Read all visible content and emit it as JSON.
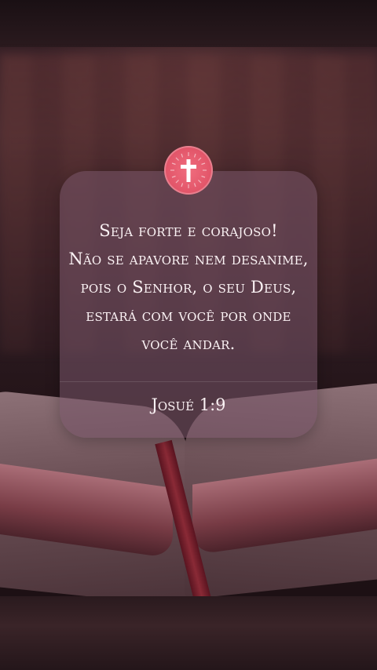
{
  "card": {
    "verse_lines": [
      "Seja forte e corajoso!",
      "Não se apavore nem desanime,",
      "pois o Senhor, o seu Deus,",
      "estará com você por onde",
      "você andar."
    ],
    "reference": "Josué 1:9"
  },
  "badge": {
    "icon": "cross-icon",
    "color": "#e25569"
  }
}
